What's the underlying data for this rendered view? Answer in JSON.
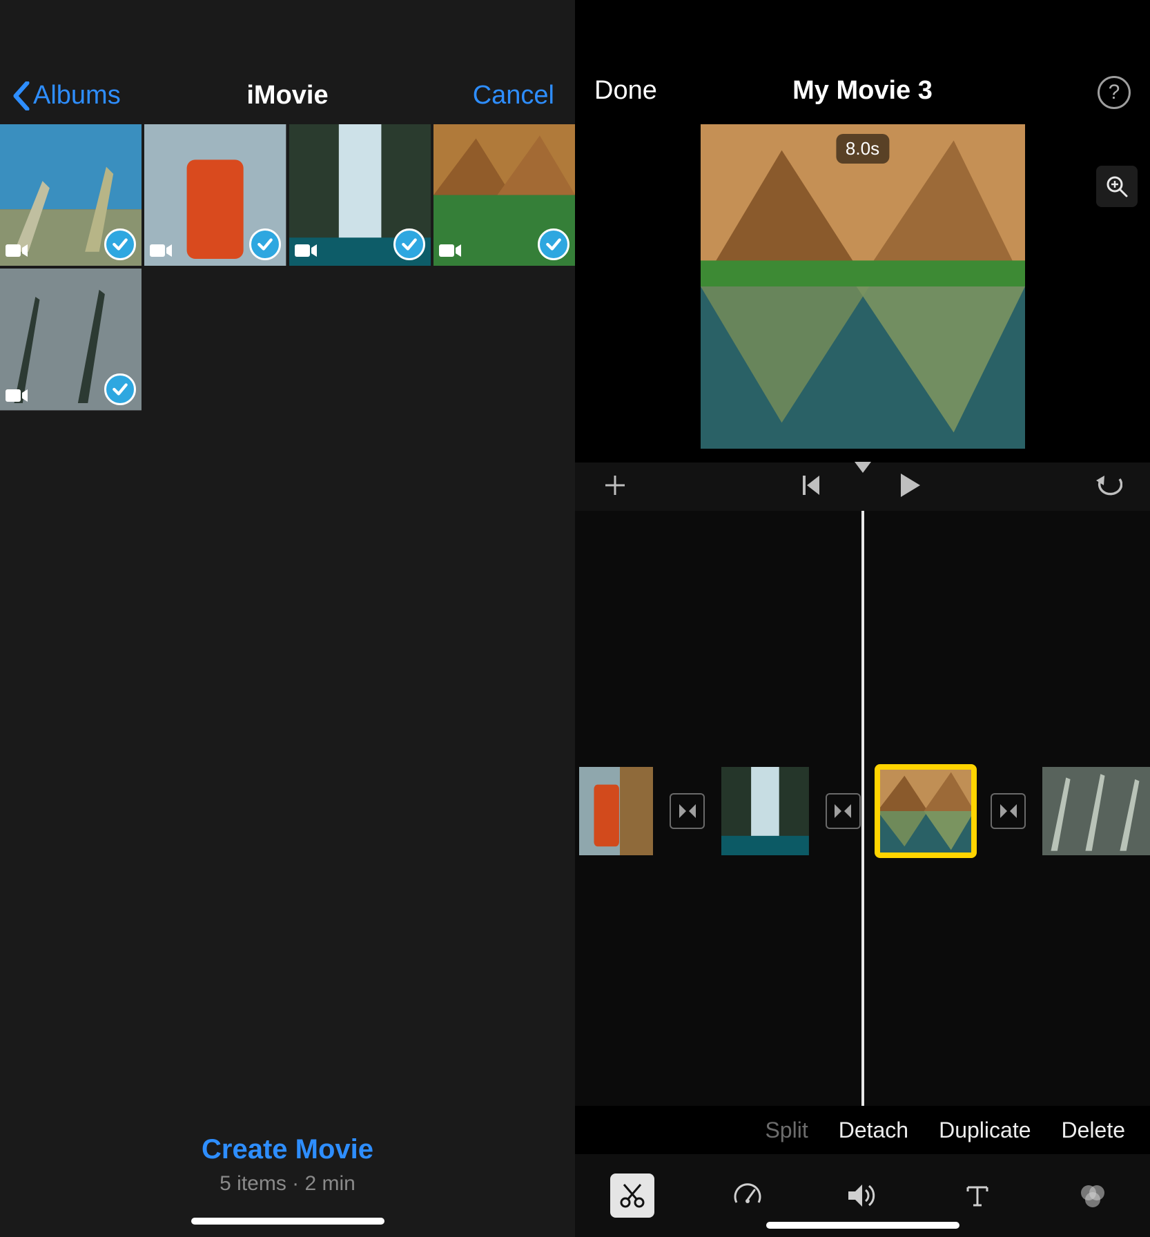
{
  "left": {
    "back_label": "Albums",
    "title": "iMovie",
    "cancel": "Cancel",
    "create_label": "Create Movie",
    "summary": "5 items · 2 min"
  },
  "right": {
    "done": "Done",
    "title": "My Movie 3",
    "duration": "8.0s",
    "actions": {
      "split": "Split",
      "detach": "Detach",
      "duplicate": "Duplicate",
      "delete": "Delete"
    }
  }
}
